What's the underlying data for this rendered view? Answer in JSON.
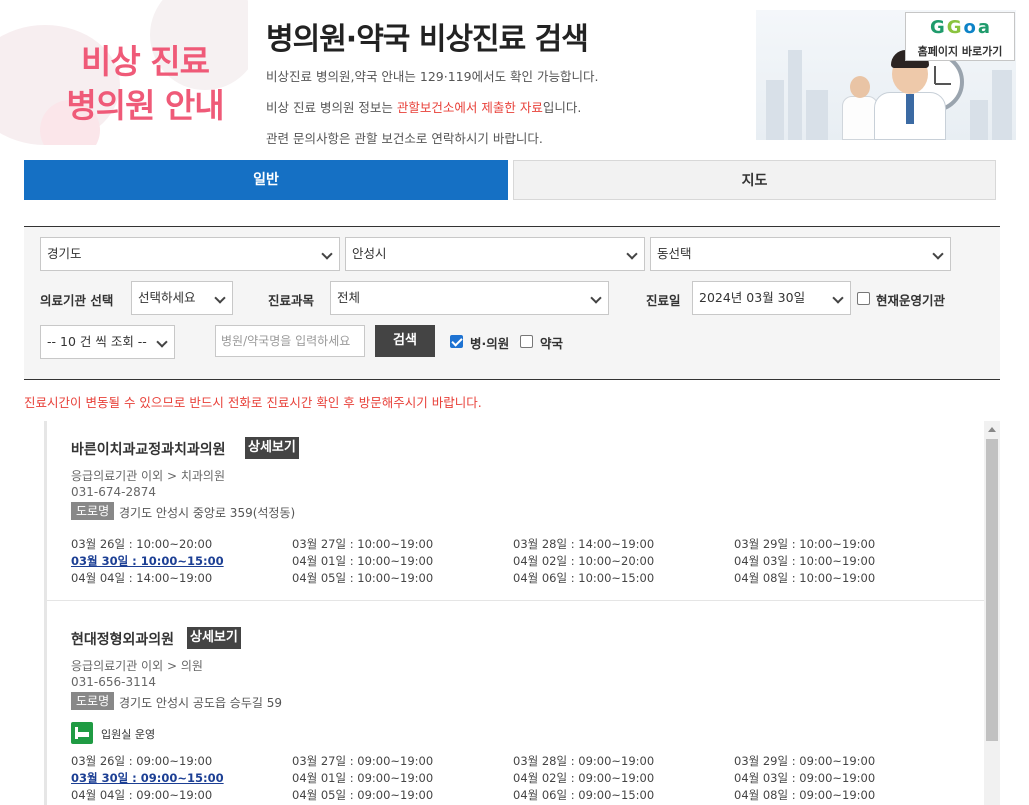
{
  "hero": {
    "line1": "비상 진료",
    "line2": "병의원 안내"
  },
  "header": {
    "title": "병의원·약국 비상진료 검색",
    "info1": "비상진료 병의원,약국 안내는 129·119에서도 확인 가능합니다.",
    "info2_pre": "비상 진료 병의원 정보는 ",
    "info2_red": "관할보건소에서 제출한 자료",
    "info2_post": "입니다.",
    "info3": "관련 문의사항은 관할 보건소로 연락하시기 바랍니다.",
    "home_logo_text": "GGoa",
    "home_button": "홈페이지 바로가기"
  },
  "tabs": [
    {
      "label": "일반",
      "active": true
    },
    {
      "label": "지도",
      "active": false
    }
  ],
  "search": {
    "province": "경기도",
    "city": "안성시",
    "dong": "동선택",
    "institution_label": "의료기관 선택",
    "institution_value": "선택하세요",
    "dept_label": "진료과목",
    "dept_value": "전체",
    "date_label": "진료일",
    "date_value": "2024년 03월 30일",
    "open_now_label": "현재운영기관",
    "page_size": "-- 10 건 씩 조회 --",
    "keyword_placeholder": "병원/약국명을 입력하세요",
    "search_button": "검색",
    "hospital_label": "병·의원",
    "hospital_checked": true,
    "pharmacy_label": "약국",
    "pharmacy_checked": false
  },
  "notice": "진료시간이 변동될 수 있으므로 반드시 전화로 진료시간 확인 후 방문해주시기 바랍니다.",
  "results": [
    {
      "name": "바른이치과교정과치과의원",
      "detail_button": "상세보기",
      "category": "응급의료기관 이외 > 치과의원",
      "tel": "031-674-2874",
      "road_tag": "도로명",
      "address": "경기도 안성시 중앙로 359(석정동)",
      "ward": "",
      "hours": [
        [
          "03월 26일 : 10:00~20:00",
          "03월 27일 : 10:00~19:00",
          "03월 28일 : 14:00~19:00",
          "03월 29일 : 10:00~19:00"
        ],
        [
          "03월 30일 : 10:00~15:00",
          "04월 01일 : 10:00~19:00",
          "04월 02일 : 10:00~20:00",
          "04월 03일 : 10:00~19:00"
        ],
        [
          "04월 04일 : 14:00~19:00",
          "04월 05일 : 10:00~19:00",
          "04월 06일 : 10:00~15:00",
          "04월 08일 : 10:00~19:00"
        ]
      ]
    },
    {
      "name": "현대정형외과의원",
      "detail_button": "상세보기",
      "category": "응급의료기관 이외 > 의원",
      "tel": "031-656-3114",
      "road_tag": "도로명",
      "address": "경기도 안성시 공도읍 승두길 59",
      "ward": "입원실 운영",
      "hours": [
        [
          "03월 26일 : 09:00~19:00",
          "03월 27일 : 09:00~19:00",
          "03월 28일 : 09:00~19:00",
          "03월 29일 : 09:00~19:00"
        ],
        [
          "03월 30일 : 09:00~15:00",
          "04월 01일 : 09:00~19:00",
          "04월 02일 : 09:00~19:00",
          "04월 03일 : 09:00~19:00"
        ],
        [
          "04월 04일 : 09:00~19:00",
          "04월 05일 : 09:00~19:00",
          "04월 06일 : 09:00~15:00",
          "04월 08일 : 09:00~19:00"
        ]
      ]
    }
  ],
  "today_label": "03월 30일",
  "colors": {
    "primary": "#1570c4",
    "accent_red": "#e8413a",
    "hero_pink": "#ef5a78",
    "ward_green": "#1f9b43"
  }
}
